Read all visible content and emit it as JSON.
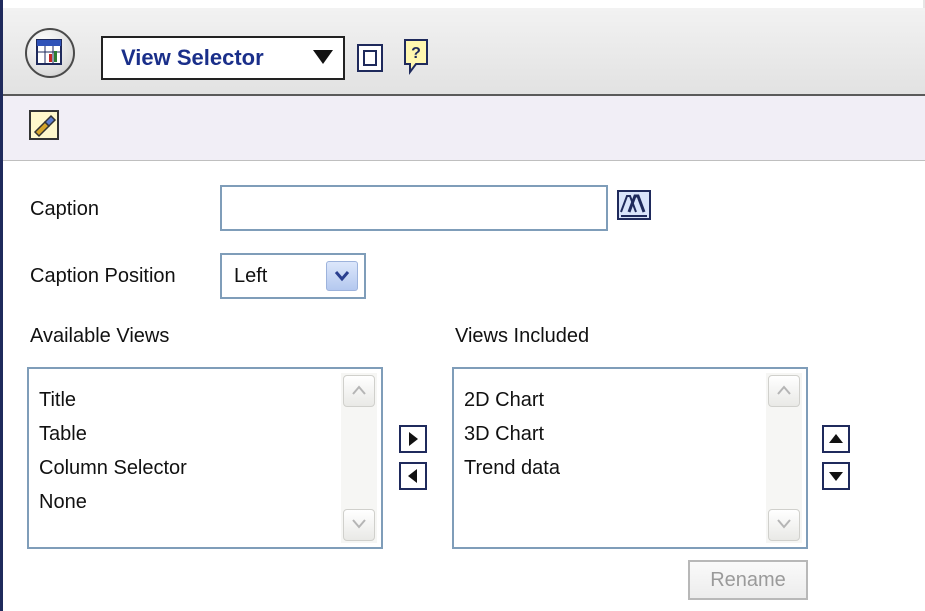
{
  "toolbar": {
    "view_selector_label": "View Selector"
  },
  "form": {
    "caption_label": "Caption",
    "caption_value": "",
    "caption_position_label": "Caption Position",
    "caption_position_value": "Left",
    "available_views_label": "Available Views",
    "views_included_label": "Views Included",
    "available_views": [
      "Title",
      "Table",
      "Column Selector",
      "None"
    ],
    "views_included": [
      "2D Chart",
      "3D Chart",
      "Trend data"
    ],
    "rename_label": "Rename"
  },
  "icons": {
    "view_type": "table-chart-icon",
    "dropdown": "triangle-down-icon",
    "properties": "properties-icon",
    "help": "help-icon",
    "format": "format-paint-icon",
    "caption_format": "text-format-icon",
    "move_right": "arrow-right-icon",
    "move_left": "arrow-left-icon",
    "move_up": "arrow-up-icon",
    "move_down": "arrow-down-icon"
  },
  "colors": {
    "accent_text": "#1a2f8a",
    "input_border": "#7f9db9",
    "toolbar_bg": "#e8e8e8",
    "subbar_bg": "#f1eef6",
    "disabled_text": "#9a9a9a"
  }
}
